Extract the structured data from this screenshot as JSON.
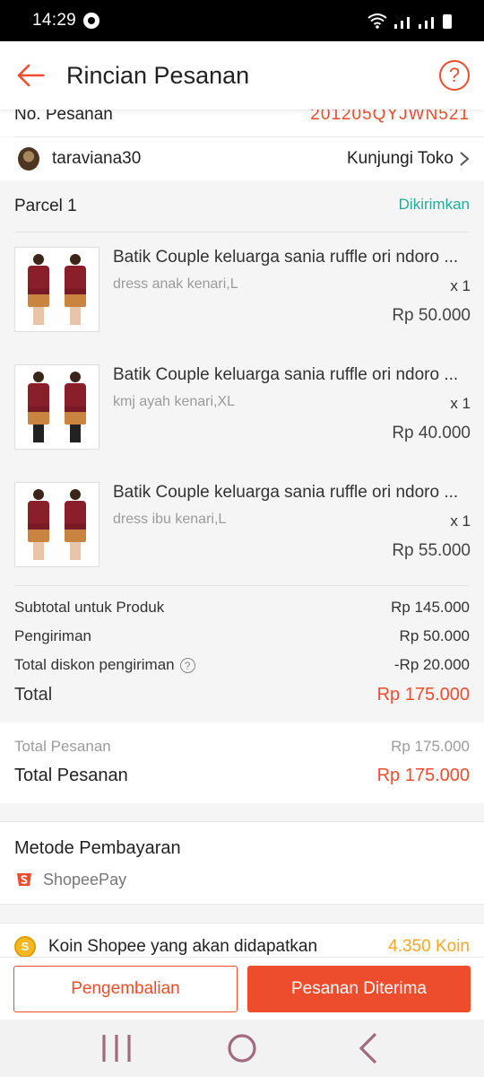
{
  "status_bar": {
    "time": "14:29"
  },
  "header": {
    "title": "Rincian Pesanan",
    "help_glyph": "?"
  },
  "order": {
    "label": "No. Pesanan",
    "number": "201205QYJWN521"
  },
  "shop": {
    "name": "taraviana30",
    "visit_label": "Kunjungi Toko"
  },
  "parcel": {
    "title": "Parcel 1",
    "status": "Dikirimkan",
    "items": [
      {
        "name": "Batik Couple keluarga sania ruffle ori ndoro ...",
        "variant": "dress anak kenari,L",
        "qty": "x 1",
        "price": "Rp 50.000"
      },
      {
        "name": "Batik Couple keluarga sania ruffle ori ndoro ...",
        "variant": "kmj ayah kenari,XL",
        "qty": "x 1",
        "price": "Rp 40.000"
      },
      {
        "name": "Batik Couple keluarga sania ruffle ori ndoro ...",
        "variant": "dress ibu kenari,L",
        "qty": "x 1",
        "price": "Rp 55.000"
      }
    ]
  },
  "summary": {
    "subtotal_label": "Subtotal untuk Produk",
    "subtotal_value": "Rp 145.000",
    "shipping_label": "Pengiriman",
    "shipping_value": "Rp 50.000",
    "discount_label": "Total diskon pengiriman",
    "discount_value": "-Rp 20.000",
    "total_label": "Total",
    "total_value": "Rp 175.000"
  },
  "order_total": {
    "row1_label": "Total Pesanan",
    "row1_value": "Rp 175.000",
    "row2_label": "Total Pesanan",
    "row2_value": "Rp 175.000"
  },
  "payment": {
    "title": "Metode Pembayaran",
    "method": "ShopeePay"
  },
  "coins": {
    "label": "Koin Shopee yang akan didapatkan",
    "value": "4.350 Koin"
  },
  "actions": {
    "return_label": "Pengembalian",
    "received_label": "Pesanan Diterima"
  },
  "colors": {
    "accent": "#ee4d2d",
    "status_green": "#26aa99",
    "coin": "#f5a623"
  },
  "icons": {
    "back": "arrow-left-icon",
    "help": "question-circle-icon",
    "chevron": "chevron-right-icon",
    "nav_recent": "recent-apps-icon",
    "nav_home": "home-icon",
    "nav_back": "nav-back-icon"
  }
}
